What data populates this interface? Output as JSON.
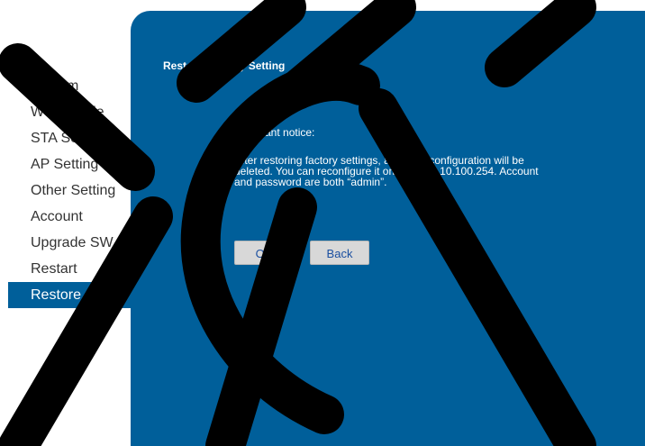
{
  "sidebar": {
    "items": [
      {
        "label": "System"
      },
      {
        "label": "Work Mode"
      },
      {
        "label": "STA Setting"
      },
      {
        "label": "AP Setting"
      },
      {
        "label": "Other Setting"
      },
      {
        "label": "Account"
      },
      {
        "label": "Upgrade SW"
      },
      {
        "label": "Restart"
      },
      {
        "label": "Restore",
        "active": true
      }
    ]
  },
  "panel": {
    "title": "Restore Factory Setting",
    "notice_title": "Important notice:",
    "notice_line1": "After restoring factory settings, all users' configuration will be",
    "notice_line2": "deleted. You can reconfigure it on http://10.10.100.254. Account",
    "notice_line3": "and password are both “admin”.",
    "ok_label": "OK",
    "back_label": "Back"
  },
  "colors": {
    "accent": "#005f9a",
    "watermark": "#000000"
  }
}
